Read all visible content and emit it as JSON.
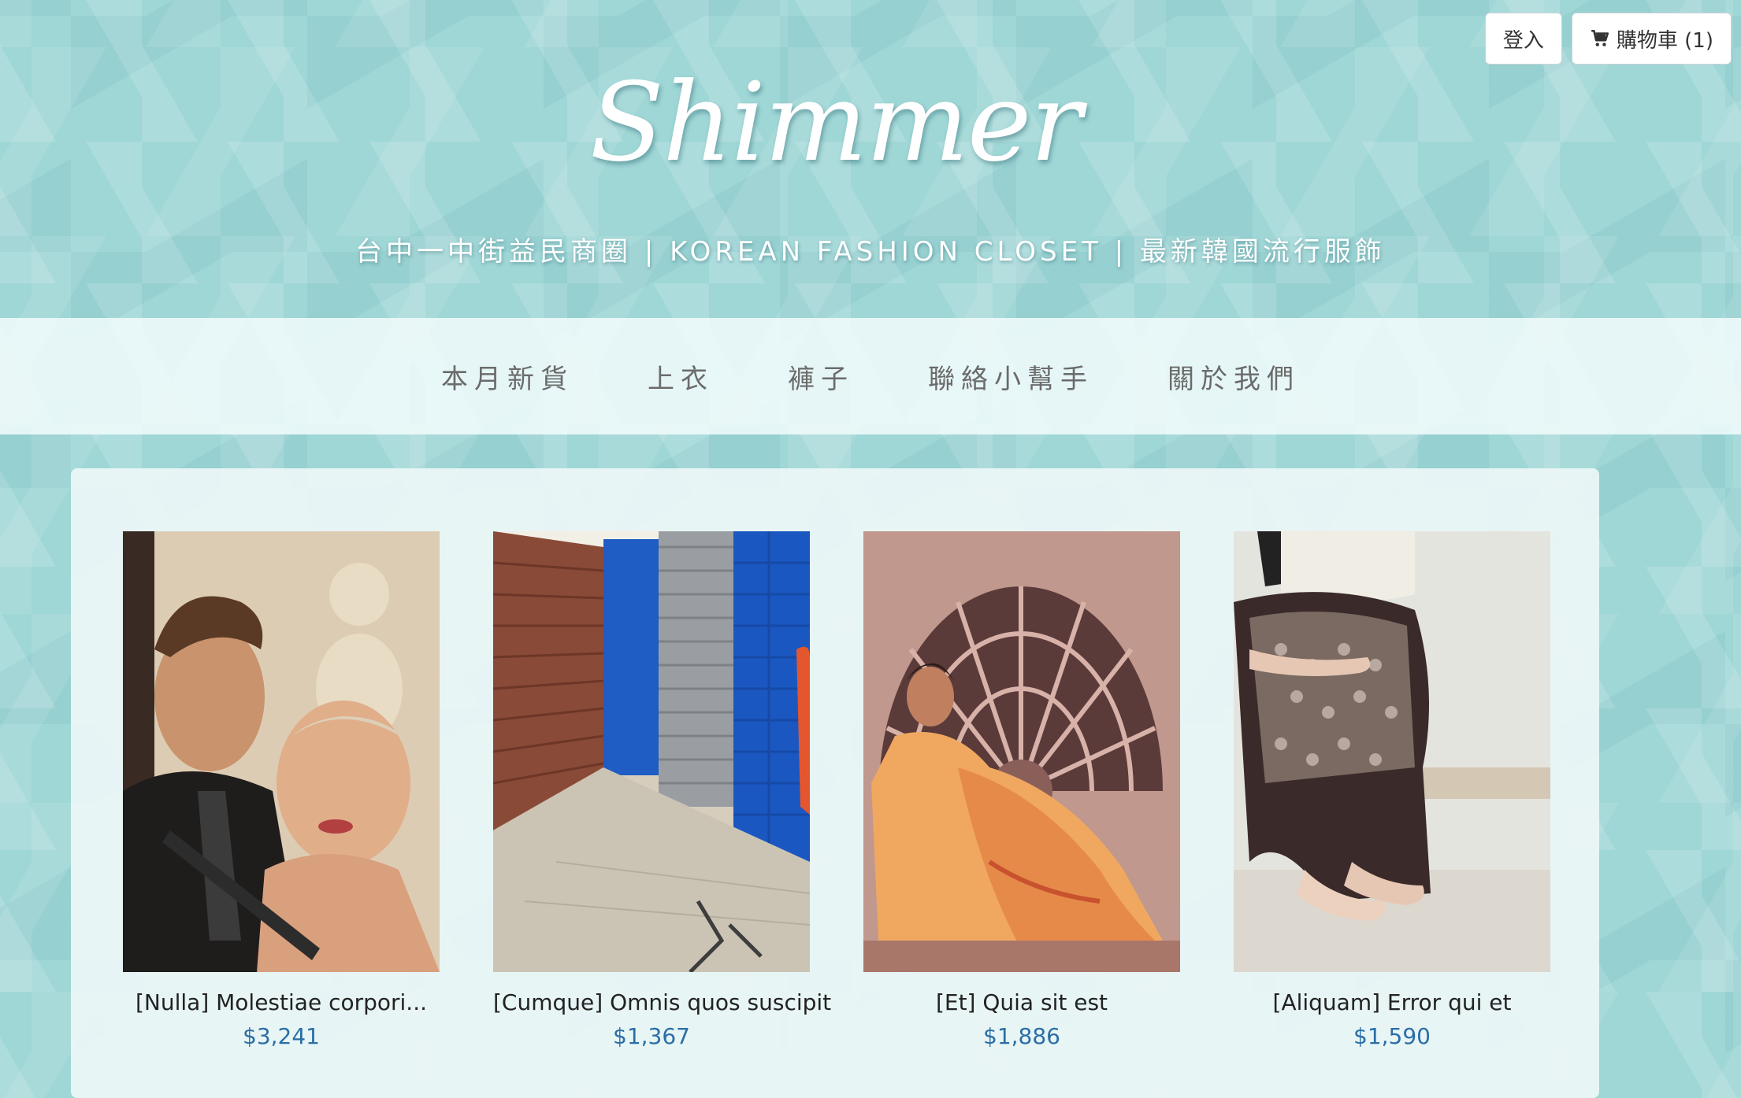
{
  "top_actions": {
    "login_label": "登入",
    "cart_label": "購物車 (1)"
  },
  "header": {
    "logo": "Shimmer",
    "tagline": "台中一中街益民商圈 | KOREAN FASHION CLOSET | 最新韓國流行服飾"
  },
  "nav": {
    "items": [
      {
        "label": "本月新貨"
      },
      {
        "label": "上衣"
      },
      {
        "label": "褲子"
      },
      {
        "label": "聯絡小幫手"
      },
      {
        "label": "關於我們"
      }
    ]
  },
  "products": [
    {
      "title": "[Nulla] Molestiae corpori...",
      "price": "$3,241"
    },
    {
      "title": "[Cumque] Omnis quos suscipit",
      "price": "$1,367"
    },
    {
      "title": "[Et] Quia sit est",
      "price": "$1,886"
    },
    {
      "title": "[Aliquam] Error qui et",
      "price": "$1,590"
    }
  ],
  "colors": {
    "background": "#9fd6d6",
    "price": "#2a6ea6",
    "nav_text": "#6b6b6b"
  }
}
